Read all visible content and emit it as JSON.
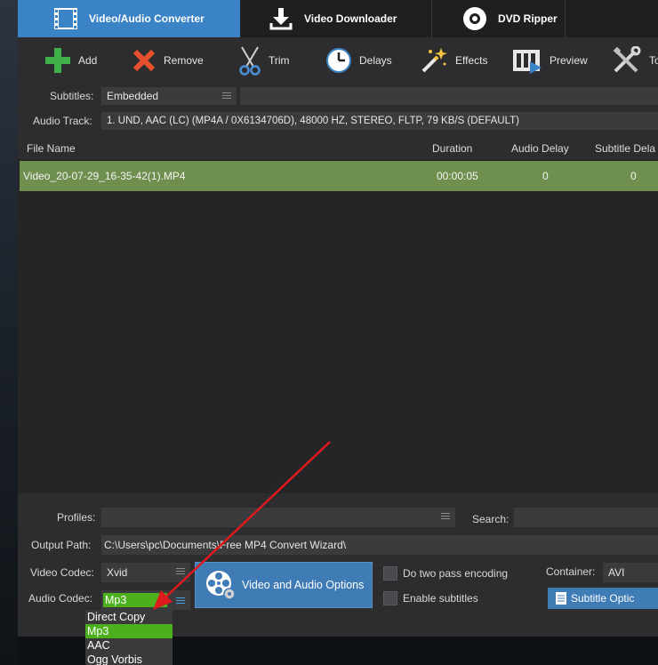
{
  "tabs": [
    {
      "label": "Video/Audio Converter",
      "icon": "film-icon",
      "active": true
    },
    {
      "label": "Video Downloader",
      "icon": "download-icon",
      "active": false
    },
    {
      "label": "DVD Ripper",
      "icon": "disc-icon",
      "active": false
    }
  ],
  "toolbar": {
    "add": "Add",
    "remove": "Remove",
    "trim": "Trim",
    "delays": "Delays",
    "effects": "Effects",
    "preview": "Preview",
    "tools": "To"
  },
  "subtitles": {
    "label": "Subtitles:",
    "value": "Embedded"
  },
  "audio_track": {
    "label": "Audio Track:",
    "value": "1. UND, AAC (LC) (MP4A / 0X6134706D), 48000 HZ, STEREO, FLTP, 79 KB/S (DEFAULT)"
  },
  "table": {
    "columns": [
      "File Name",
      "Duration",
      "Audio Delay",
      "Subtitle Dela"
    ],
    "rows": [
      {
        "name": "Video_20-07-29_16-35-42(1).MP4",
        "duration": "00:00:05",
        "audio_delay": "0",
        "subtitle_delay": "0"
      }
    ]
  },
  "bottom": {
    "profiles_label": "Profiles:",
    "search_label": "Search:",
    "output_label": "Output Path:",
    "output_value": "C:\\Users\\pc\\Documents\\Free MP4 Convert Wizard\\",
    "video_codec_label": "Video Codec:",
    "video_codec_value": "Xvid",
    "audio_codec_label": "Audio Codec:",
    "audio_codec_value": "Mp3",
    "options_button": "Video and Audio Options",
    "two_pass": "Do two pass encoding",
    "enable_subtitles": "Enable subtitles",
    "container_label": "Container:",
    "container_value": "AVI",
    "subtitle_button": "Subtitle Optic"
  },
  "audio_codec_options": [
    "Direct Copy",
    "Mp3",
    "AAC",
    "Ogg Vorbis"
  ],
  "audio_codec_selected": "Mp3",
  "colors": {
    "tab_active": "#3a83c6",
    "row_selected": "#6f8f4e",
    "option_selected": "#4caf1c",
    "add_icon": "#3fb04a",
    "remove_icon": "#e6502c",
    "arrow": "#e0191c"
  }
}
